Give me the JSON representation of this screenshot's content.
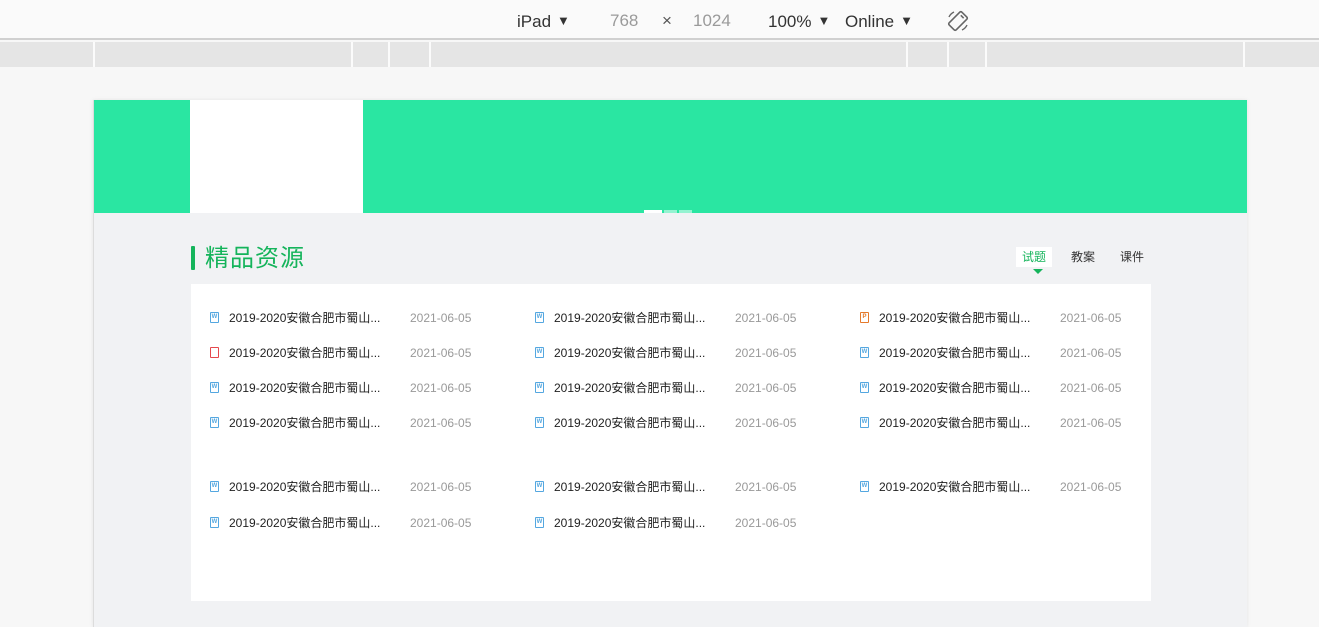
{
  "toolbar": {
    "device": "iPad",
    "width": "768",
    "times": "×",
    "height": "1024",
    "zoom": "100%",
    "network": "Online",
    "rotate_icon": "rotate-icon"
  },
  "section": {
    "title": "精品资源",
    "tabs": [
      {
        "label": "试题",
        "active": true
      },
      {
        "label": "教案",
        "active": false
      },
      {
        "label": "课件",
        "active": false
      }
    ]
  },
  "banner": {
    "color": "#2ae6a2",
    "slides": 3,
    "active_slide": 0
  },
  "resources": [
    {
      "icon": "word-file-icon",
      "type": "w",
      "name": "2019-2020安徽合肥市蜀山...",
      "date": "2021-06-05"
    },
    {
      "icon": "word-file-icon",
      "type": "w",
      "name": "2019-2020安徽合肥市蜀山...",
      "date": "2021-06-05"
    },
    {
      "icon": "ppt-file-icon",
      "type": "p",
      "name": "2019-2020安徽合肥市蜀山...",
      "date": "2021-06-05"
    },
    {
      "icon": "pdf-file-icon",
      "type": "pdf",
      "name": "2019-2020安徽合肥市蜀山...",
      "date": "2021-06-05"
    },
    {
      "icon": "word-file-icon",
      "type": "w",
      "name": "2019-2020安徽合肥市蜀山...",
      "date": "2021-06-05"
    },
    {
      "icon": "word-file-icon",
      "type": "w",
      "name": "2019-2020安徽合肥市蜀山...",
      "date": "2021-06-05"
    },
    {
      "icon": "word-file-icon",
      "type": "w",
      "name": "2019-2020安徽合肥市蜀山...",
      "date": "2021-06-05"
    },
    {
      "icon": "word-file-icon",
      "type": "w",
      "name": "2019-2020安徽合肥市蜀山...",
      "date": "2021-06-05"
    },
    {
      "icon": "word-file-icon",
      "type": "w",
      "name": "2019-2020安徽合肥市蜀山...",
      "date": "2021-06-05"
    },
    {
      "icon": "word-file-icon",
      "type": "w",
      "name": "2019-2020安徽合肥市蜀山...",
      "date": "2021-06-05"
    },
    {
      "icon": "word-file-icon",
      "type": "w",
      "name": "2019-2020安徽合肥市蜀山...",
      "date": "2021-06-05"
    },
    {
      "icon": "word-file-icon",
      "type": "w",
      "name": "2019-2020安徽合肥市蜀山...",
      "date": "2021-06-05"
    },
    {
      "icon": "word-file-icon",
      "type": "w",
      "name": "2019-2020安徽合肥市蜀山...",
      "date": "2021-06-05"
    },
    {
      "icon": "word-file-icon",
      "type": "w",
      "name": "2019-2020安徽合肥市蜀山...",
      "date": "2021-06-05"
    },
    {
      "icon": "word-file-icon",
      "type": "w",
      "name": "2019-2020安徽合肥市蜀山...",
      "date": "2021-06-05"
    },
    {
      "icon": "word-file-icon",
      "type": "w",
      "name": "2019-2020安徽合肥市蜀山...",
      "date": "2021-06-05"
    },
    {
      "icon": "word-file-icon",
      "type": "w",
      "name": "2019-2020安徽合肥市蜀山...",
      "date": "2021-06-05"
    }
  ],
  "colors": {
    "accent": "#15b45b",
    "word": "#54a7e0",
    "pdf": "#e5484d",
    "ppt": "#e57a2c"
  }
}
